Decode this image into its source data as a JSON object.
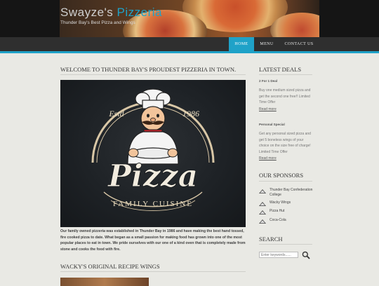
{
  "site": {
    "title_part1": "Swayze's",
    "title_part2": "Pizzeria",
    "tagline": "Thunder Bay's Best Pizza and Wings"
  },
  "nav": {
    "items": [
      {
        "label": "HOME",
        "active": true
      },
      {
        "label": "MENU",
        "active": false
      },
      {
        "label": "CONTACT US",
        "active": false
      }
    ]
  },
  "main": {
    "heading": "WELCOME TO THUNDER BAY'S PROUDEST PIZZERIA IN TOWN.",
    "hero": {
      "estd_label": "Estd",
      "year": "1986",
      "logo_word": "Pizza",
      "logo_sub": "FAMILY CUISINE"
    },
    "intro": "Our family owned pizzeria was established in Thunder Bay in 1986 and have making the best hand tossed, fire cooked pizza to date. What began as a small passion for making food has grown into one of the most popular places to eat in town. We pride ourselves with our one of a kind oven that is completely made from stone and cooks the food with fire.",
    "section2_heading": "WACKY'S ORIGINAL RECIPE WINGS"
  },
  "sidebar": {
    "deals_heading": "LATEST DEALS",
    "deals": [
      {
        "title": "2 For 1 Deal",
        "text": "Buy one medium sized pizza and get the second one free!! Limited Time Offer",
        "read_more": "Read more"
      },
      {
        "title": "Personal Special",
        "text": "Get any personal sized pizza and get 5 boneless wings of your choice on the size free of charge! Limited Time Offer",
        "read_more": "Read more"
      }
    ],
    "sponsors_heading": "OUR SPONSORS",
    "sponsors": [
      {
        "name": "Thunder Bay Confederation College"
      },
      {
        "name": "Wacky Wings"
      },
      {
        "name": "Pizza Hut"
      },
      {
        "name": "Coca-Cola"
      }
    ],
    "search_heading": "SEARCH",
    "search_placeholder": "Enter keywords......"
  },
  "colors": {
    "accent": "#1fa2c8",
    "nav_bg": "#2f2f2f",
    "page_bg": "#e9e9e4"
  }
}
